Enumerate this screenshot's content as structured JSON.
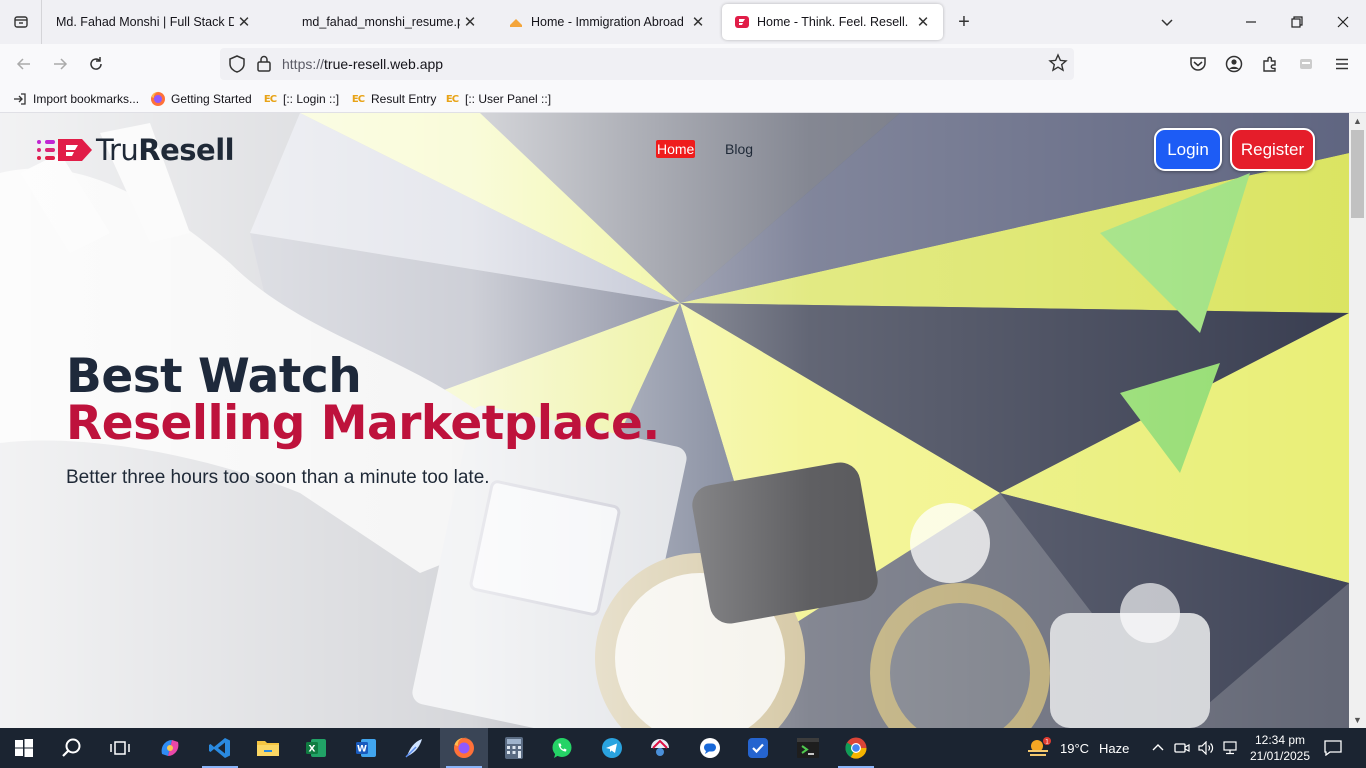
{
  "browser": {
    "tabs": [
      {
        "title": "Md. Fahad Monshi | Full Stack Developer",
        "active": false
      },
      {
        "title": "md_fahad_monshi_resume.pdf",
        "active": false
      },
      {
        "title": "Home - Immigration Abroad",
        "active": false
      },
      {
        "title": "Home - Think. Feel. Resell.",
        "active": true
      }
    ],
    "url_scheme": "https://",
    "url_host": "true-resell.web.app",
    "bookmarks": [
      {
        "label": "Import bookmarks...",
        "icon": "import-icon"
      },
      {
        "label": "Getting Started",
        "icon": "firefox-icon"
      },
      {
        "label": "[:: Login ::]",
        "icon": "ec-icon"
      },
      {
        "label": "Result Entry",
        "icon": "ec-icon"
      },
      {
        "label": "[:: User Panel ::]",
        "icon": "ec-icon"
      }
    ]
  },
  "site": {
    "logo": {
      "part1": "Tru",
      "part2": "Resell"
    },
    "nav": [
      {
        "label": "Home",
        "active": true
      },
      {
        "label": "Blog",
        "active": false
      }
    ],
    "login_label": "Login",
    "register_label": "Register",
    "hero": {
      "title_line1": "Best Watch",
      "title_line2": "Reselling Marketplace.",
      "subtitle": "Better three hours too soon than a minute too late."
    },
    "colors": {
      "accent_red": "#be123c",
      "login_blue": "#1d5cf5",
      "register_red": "#e51d2a"
    }
  },
  "taskbar": {
    "apps": [
      "windows-start",
      "search",
      "task-view",
      "copilot",
      "vscode",
      "file-explorer",
      "excel",
      "word",
      "feather-app",
      "firefox",
      "calculator",
      "whatsapp",
      "telegram",
      "network-app",
      "chat-app",
      "todo",
      "terminal",
      "chrome"
    ],
    "weather": {
      "temp": "19°C",
      "condition": "Haze"
    },
    "time": "12:34 pm",
    "date": "21/01/2025"
  }
}
